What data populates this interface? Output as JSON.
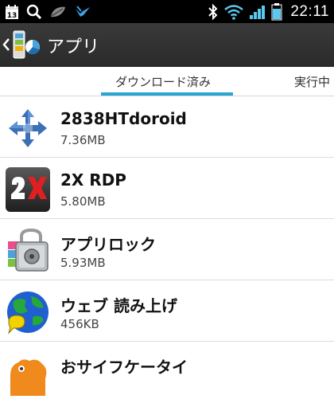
{
  "status_bar": {
    "calendar_badge": "13",
    "time": "22:11",
    "icons": [
      "calendar-icon",
      "search-icon",
      "leaf-icon",
      "bird-icon",
      "bluetooth-icon",
      "wifi-icon",
      "signal-icon",
      "battery-icon"
    ]
  },
  "action_bar": {
    "title": "アプリ",
    "icons": [
      "back-chevron-icon",
      "app-manager-icon"
    ]
  },
  "tabs": [
    {
      "label": "ダウンロード済み",
      "selected": true
    },
    {
      "label": "実行中",
      "selected": false
    }
  ],
  "apps": [
    {
      "name": "2838HTdoroid",
      "size": "7.36MB",
      "icon": "arrows-cross-icon"
    },
    {
      "name": "2X RDP",
      "size": "5.80MB",
      "icon": "2x-logo-icon"
    },
    {
      "name": "アプリロック",
      "size": "5.93MB",
      "icon": "safe-lock-icon"
    },
    {
      "name": "ウェブ 読み上げ",
      "size": "456KB",
      "icon": "globe-speech-icon"
    },
    {
      "name": "おサイフケータイ",
      "size": "",
      "icon": "osaifu-icon"
    }
  ],
  "colors": {
    "accent": "#29a6d6",
    "status_bar": "#000000",
    "action_bar": "#333333",
    "battery": "#5bc8f0"
  }
}
